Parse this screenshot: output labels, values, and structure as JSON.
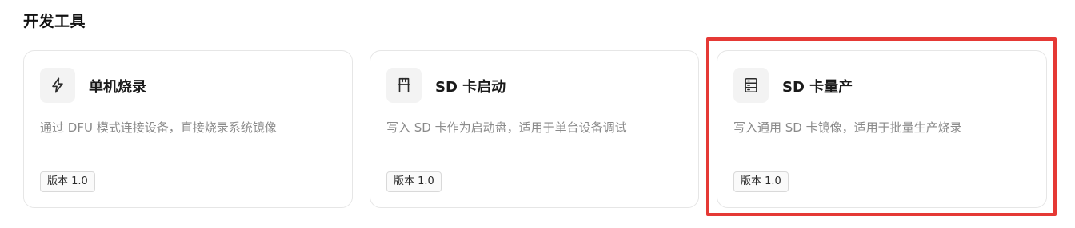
{
  "section": {
    "title": "开发工具"
  },
  "cards": [
    {
      "icon": "lightning-icon",
      "title": "单机烧录",
      "description": "通过 DFU 模式连接设备，直接烧录系统镜像",
      "version": "版本 1.0"
    },
    {
      "icon": "sd-card-icon",
      "title": "SD 卡启动",
      "description": "写入 SD 卡作为启动盘，适用于单台设备调试",
      "version": "版本 1.0"
    },
    {
      "icon": "server-rack-icon",
      "title": "SD 卡量产",
      "description": "写入通用 SD 卡镜像，适用于批量生产烧录",
      "version": "版本 1.0"
    }
  ],
  "colors": {
    "highlight": "#e53935",
    "card_border": "#e6e6e6",
    "icon_bg": "#f3f3f3",
    "description": "#8a8a8a"
  }
}
